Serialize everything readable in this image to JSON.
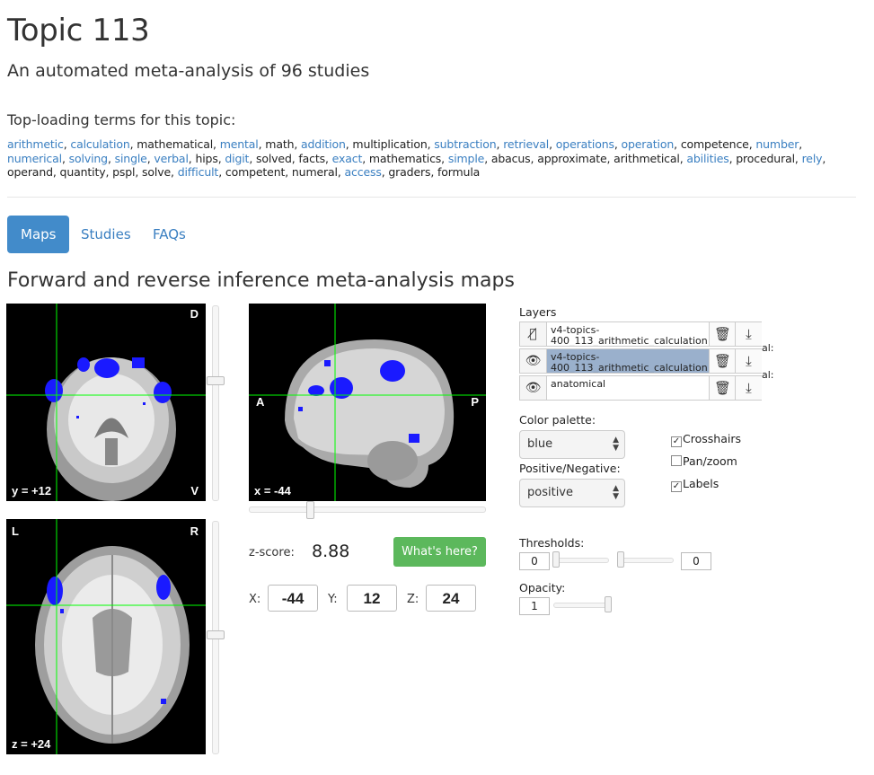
{
  "page": {
    "title": "Topic 113",
    "subtitle": "An automated meta-analysis of 96 studies",
    "terms_heading": "Top-loading terms for this topic:",
    "terms": [
      {
        "text": "arithmetic",
        "link": true
      },
      {
        "text": "calculation",
        "link": true
      },
      {
        "text": "mathematical",
        "link": false
      },
      {
        "text": "mental",
        "link": true
      },
      {
        "text": "math",
        "link": false
      },
      {
        "text": "addition",
        "link": true
      },
      {
        "text": "multiplication",
        "link": false
      },
      {
        "text": "subtraction",
        "link": true
      },
      {
        "text": "retrieval",
        "link": true
      },
      {
        "text": "operations",
        "link": true
      },
      {
        "text": "operation",
        "link": true
      },
      {
        "text": "competence",
        "link": false
      },
      {
        "text": "number",
        "link": true
      },
      {
        "text": "numerical",
        "link": true
      },
      {
        "text": "solving",
        "link": true
      },
      {
        "text": "single",
        "link": true
      },
      {
        "text": "verbal",
        "link": true
      },
      {
        "text": "hips",
        "link": false
      },
      {
        "text": "digit",
        "link": true
      },
      {
        "text": "solved",
        "link": false
      },
      {
        "text": "facts",
        "link": false
      },
      {
        "text": "exact",
        "link": true
      },
      {
        "text": "mathematics",
        "link": false
      },
      {
        "text": "simple",
        "link": true
      },
      {
        "text": "abacus",
        "link": false
      },
      {
        "text": "approximate",
        "link": false
      },
      {
        "text": "arithmetical",
        "link": false
      },
      {
        "text": "abilities",
        "link": true
      },
      {
        "text": "procedural",
        "link": false
      },
      {
        "text": "rely",
        "link": true
      },
      {
        "text": "operand",
        "link": false
      },
      {
        "text": "quantity",
        "link": false
      },
      {
        "text": "pspl",
        "link": false
      },
      {
        "text": "solve",
        "link": false
      },
      {
        "text": "difficult",
        "link": true
      },
      {
        "text": "competent",
        "link": false
      },
      {
        "text": "numeral",
        "link": false
      },
      {
        "text": "access",
        "link": true
      },
      {
        "text": "graders",
        "link": false
      },
      {
        "text": "formula",
        "link": false
      }
    ],
    "section_title": "Forward and reverse inference meta-analysis maps"
  },
  "tabs": {
    "maps": "Maps",
    "studies": "Studies",
    "faqs": "FAQs"
  },
  "viewer": {
    "coronal": {
      "top_label": "D",
      "bottom_right": "V",
      "coord": "y = +12"
    },
    "sagittal": {
      "left": "A",
      "right": "P",
      "coord": "x = -44"
    },
    "axial": {
      "top_left": "L",
      "top_right": "R",
      "coord": "z = +24"
    },
    "zscore_label": "z-score:",
    "zscore_value": "8.88",
    "whats_here": "What's here?",
    "x_label": "X:",
    "y_label": "Y:",
    "z_label": "Z:",
    "x": "-44",
    "y": "12",
    "z": "24"
  },
  "layers": {
    "title": "Layers",
    "items": [
      {
        "name": "v4-topics-400_113_arithmetic_calculation",
        "visible_icon": "eye-slash-icon",
        "selected": false
      },
      {
        "name": "v4-topics-400_113_arithmetic_calculation",
        "visible_icon": "eye-icon",
        "selected": true
      },
      {
        "name": "anatomical",
        "visible_icon": "eye-icon",
        "selected": false
      }
    ],
    "overflow_suffix_1": "al:",
    "overflow_suffix_2": "al:"
  },
  "controls": {
    "color_palette_label": "Color palette:",
    "color_palette_value": "blue",
    "posneg_label": "Positive/Negative:",
    "posneg_value": "positive",
    "crosshairs": {
      "label": "Crosshairs",
      "checked": true
    },
    "panzoom": {
      "label": "Pan/zoom",
      "checked": false
    },
    "labels": {
      "label": "Labels",
      "checked": true
    },
    "thresholds_label": "Thresholds:",
    "threshold_low": "0",
    "threshold_high": "0",
    "opacity_label": "Opacity:",
    "opacity_value": "1"
  },
  "colors": {
    "link": "#3a7fc1",
    "tab_active": "#428bca",
    "button_green": "#5cb85c",
    "activation": "#1a1aff",
    "crosshair": "#00ff00"
  }
}
